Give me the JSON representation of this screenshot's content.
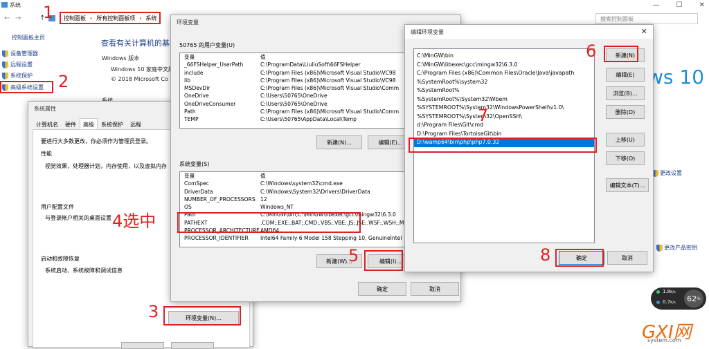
{
  "window": {
    "title": "系统",
    "controls": [
      "—",
      "☐",
      "✕"
    ]
  },
  "nav": {
    "back": "←",
    "forward": "→",
    "up": "↑",
    "breadcrumb": [
      "控制面板",
      "所有控制面板项",
      "系统"
    ],
    "separator": "›",
    "search_placeholder": "搜索控制面板"
  },
  "sidebar": {
    "home": "控制面板主页",
    "items": [
      {
        "label": "设备管理器"
      },
      {
        "label": "远程设置"
      },
      {
        "label": "系统保护"
      },
      {
        "label": "高级系统设置"
      }
    ]
  },
  "main": {
    "heading": "查看有关计算机的基本",
    "win_edition_label": "Windows 版本",
    "edition": "Windows 10 家庭中文版",
    "copyright": "© 2018 Microsoft Co",
    "system_label": "系统",
    "win10_logo": "ws 10",
    "change_settings": "更改设置",
    "change_key": "更改产品密钥"
  },
  "sysprop": {
    "title": "系统属性",
    "tabs": [
      "计算机名",
      "硬件",
      "高级",
      "系统保护",
      "远程"
    ],
    "notice": "要进行大多数更改，你必须作为管理员登录。",
    "perf_title": "性能",
    "perf_desc": "视觉效果，处理器计划，内存使用，以及虚拟内存",
    "profile_title": "用户配置文件",
    "profile_desc": "与登录帐户相关的桌面设置",
    "startup_title": "启动和故障恢复",
    "startup_desc": "系统启动、系统故障和调试信息",
    "env_button": "环境变量(N)..."
  },
  "env": {
    "title": "环境变量",
    "user_section": "50765 的用户变量(U)",
    "col_var": "变量",
    "col_val": "值",
    "user_vars": [
      [
        "_66FSHelper_UserPath",
        "C:\\ProgramData\\LiuliuSoft\\66FSHelper"
      ],
      [
        "include",
        "C:\\Program Files (x86)\\Microsoft Visual Studio\\VC98"
      ],
      [
        "lib",
        "C:\\Program Files (x86)\\Microsoft Visual Studio\\VC98"
      ],
      [
        "MSDevDir",
        "C:\\Program Files (x86)\\Microsoft Visual Studio\\Comm"
      ],
      [
        "OneDrive",
        "C:\\Users\\50765\\OneDrive"
      ],
      [
        "OneDriveConsumer",
        "C:\\Users\\50765\\OneDrive"
      ],
      [
        "Path",
        "C:\\Program Files (x86)\\Microsoft Visual Studio\\Comm"
      ],
      [
        "TEMP",
        "C:\\Users\\50765\\AppData\\Local\\Temp"
      ]
    ],
    "user_new": "新建(N)...",
    "user_edit": "编辑(E)...",
    "sys_section": "系统变量(S)",
    "sys_vars": [
      [
        "ComSpec",
        "C:\\Windows\\system32\\cmd.exe"
      ],
      [
        "DriverData",
        "C:\\Windows\\System32\\Drivers\\DriverData"
      ],
      [
        "NUMBER_OF_PROCESSORS",
        "12"
      ],
      [
        "OS",
        "Windows_NT"
      ],
      [
        "Path",
        "C:\\MinGW\\bin;C:\\MinGW\\libexec\\gcc\\mingw32\\6.3.0"
      ],
      [
        "PATHEXT",
        ".COM;.EXE;.BAT;.CMD;.VBS;.VBE;.JS;.JSE;.WSF;.WSH;.M"
      ],
      [
        "PROCESSOR_ARCHITECTURE",
        "AMD64"
      ],
      [
        "PROCESSOR_IDENTIFIER",
        "Intel64 Family 6 Model 158 Stepping 10, GenuineIntel"
      ]
    ],
    "sys_new": "新建(W)...",
    "sys_edit": "编辑(I)...",
    "ok": "确定",
    "cancel": "取消"
  },
  "edit": {
    "title": "编辑环境变量",
    "entries": [
      "C:\\MinGW\\bin",
      "C:\\MinGW\\libexec\\gcc\\mingw32\\6.3.0",
      "C:\\Program Files (x86)\\Common Files\\Oracle\\Java\\javapath",
      "%SystemRoot%\\system32",
      "%SystemRoot%",
      "%SystemRoot%\\System32\\Wbem",
      "%SYSTEMROOT%\\System32\\WindowsPowerShell\\v1.0\\",
      "%SYSTEMROOT%\\System32\\OpenSSH\\",
      "d:\\Program Files\\Git\\cmd",
      "D:\\Program Files\\TortoiseGit\\bin",
      "D:\\wamp64\\bin\\php\\php7.0.32"
    ],
    "selected_index": 10,
    "buttons": {
      "new": "新建(N)",
      "edit": "编辑(E)",
      "browse": "浏览(B)...",
      "delete": "删除(D)",
      "up": "上移(U)",
      "down": "下移(O)",
      "edit_text": "编辑文本(T)..."
    },
    "ok": "确定",
    "cancel": "取消"
  },
  "annotations": [
    "1",
    "2",
    "3",
    "4选中",
    "5",
    "6",
    "7",
    "8"
  ],
  "widget": {
    "up_speed": "1.8",
    "down_speed": "0.7",
    "unit": "K/s",
    "percent": "62",
    "percent_unit": "%"
  },
  "watermark": {
    "logo": "GXI网",
    "site": "system.com"
  }
}
